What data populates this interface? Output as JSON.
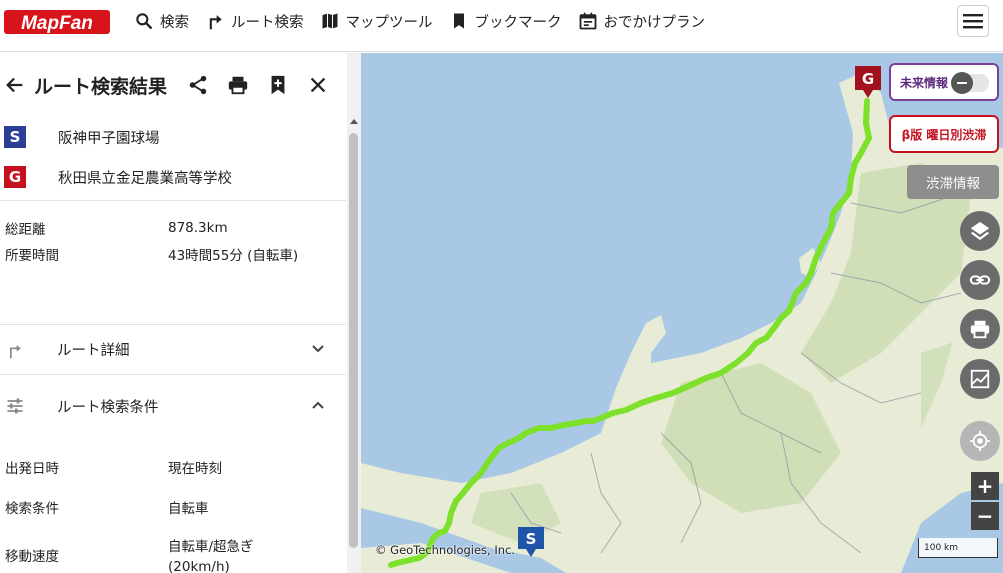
{
  "header": {
    "logo_text": "MapFan",
    "nav": [
      {
        "icon": "search-icon",
        "label": "検索"
      },
      {
        "icon": "route-turn-icon",
        "label": "ルート検索"
      },
      {
        "icon": "map-icon",
        "label": "マップツール"
      },
      {
        "icon": "bookmark-icon",
        "label": "ブックマーク"
      },
      {
        "icon": "calendar-icon",
        "label": "おでかけプラン"
      }
    ],
    "menu_icon": "hamburger-icon"
  },
  "panel": {
    "title": "ルート検索結果",
    "start": {
      "badge": "S",
      "name": "阪神甲子園球場"
    },
    "goal": {
      "badge": "G",
      "name": "秋田県立金足農業高等学校"
    },
    "summary": [
      {
        "key": "総距離",
        "value": "878.3km"
      },
      {
        "key": "所要時間",
        "value": "43時間55分 (自転車)"
      }
    ],
    "sections": {
      "detail": "ルート詳細",
      "conditions": "ルート検索条件"
    },
    "conditions": [
      {
        "key": "出発日時",
        "value": "現在時刻"
      },
      {
        "key": "検索条件",
        "value": "自転車"
      },
      {
        "key": "移動速度",
        "value": "自転車/超急ぎ\n(20km/h)"
      }
    ]
  },
  "map": {
    "future_info_label": "未来情報",
    "beta_label": "β版 曜日別渋滞",
    "traffic_label": "渋滞情報",
    "goal_badge": "G",
    "start_badge": "S",
    "zoom_in": "+",
    "zoom_out": "−",
    "copyright": "© GeoTechnologies, Inc.",
    "scale": "100 km",
    "colors": {
      "route": "#7de02a",
      "sea": "#a8c8e6",
      "land": "#e8ecd6",
      "forest": "#c9dcb0"
    }
  }
}
